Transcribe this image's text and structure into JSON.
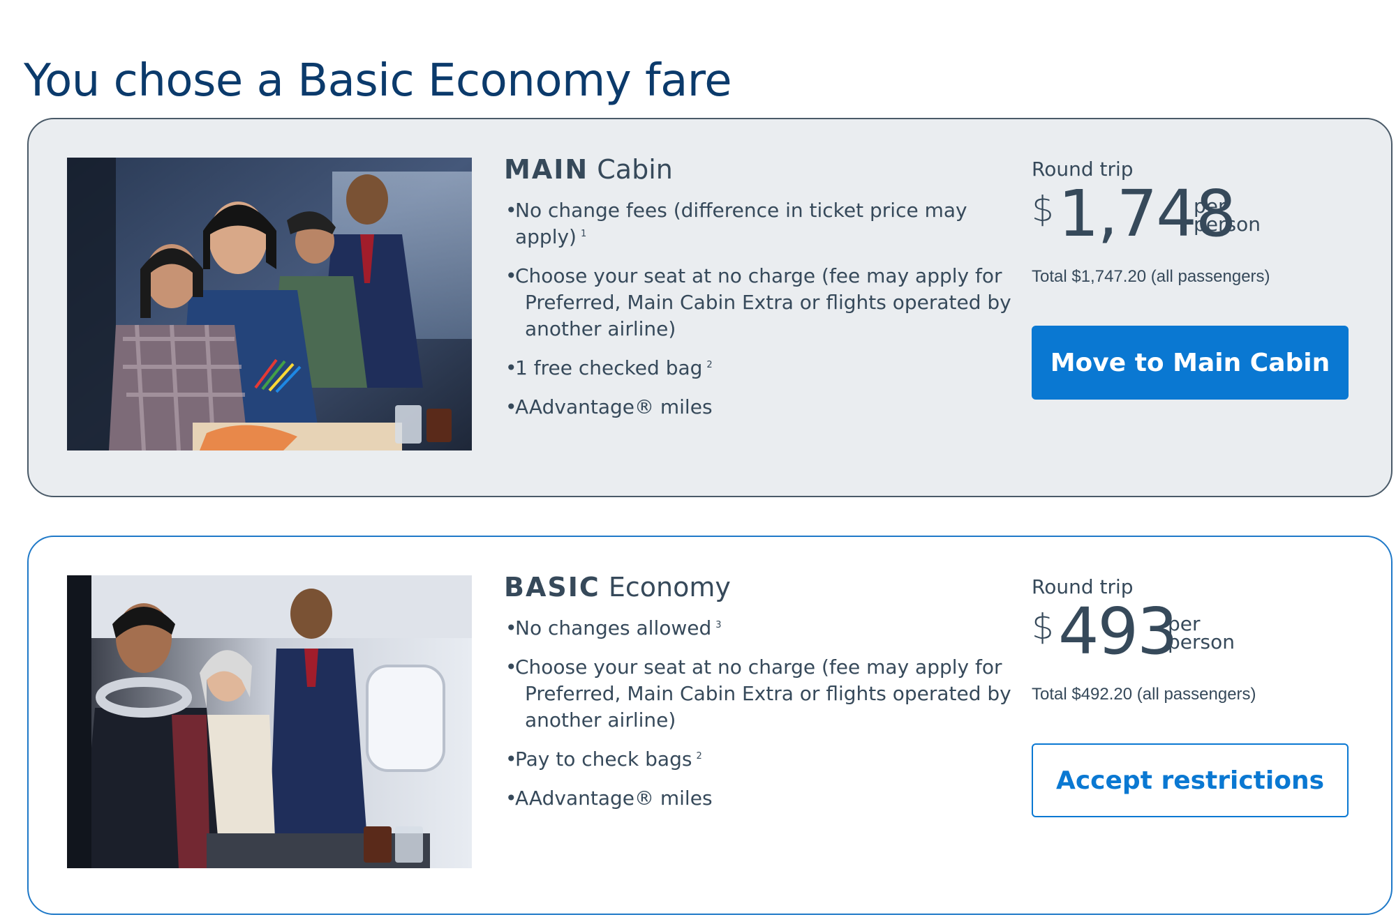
{
  "page": {
    "title": "You chose a Basic Economy fare"
  },
  "colors": {
    "accent": "#0a78d2",
    "title": "#0b3a6b",
    "text": "#36495a",
    "card_bg": "#eaedf0"
  },
  "options": [
    {
      "title_strong": "MAIN",
      "title_rest": "Cabin",
      "features": [
        {
          "text": "No change fees (difference in ticket price may apply)",
          "cont": "",
          "note": "1"
        },
        {
          "text": "Choose your seat at no charge (fee may apply for",
          "cont": "Preferred, Main Cabin Extra or flights operated by another airline)",
          "note": ""
        },
        {
          "text": "1 free checked bag",
          "cont": "",
          "note": "2"
        },
        {
          "text": "AAdvantage® miles",
          "cont": "",
          "note": ""
        }
      ],
      "trip_label": "Round trip",
      "currency": "$",
      "amount": "1,748",
      "per": "per",
      "person": "person",
      "total": "Total $1,747.20 (all passengers)",
      "button_label": "Move to Main Cabin"
    },
    {
      "title_strong": "BASIC",
      "title_rest": "Economy",
      "features": [
        {
          "text": "No changes allowed",
          "cont": "",
          "note": "3"
        },
        {
          "text": "Choose your seat at no charge (fee may apply for",
          "cont": "Preferred, Main Cabin Extra or flights operated by another airline)",
          "note": ""
        },
        {
          "text": "Pay to check bags",
          "cont": "",
          "note": "2"
        },
        {
          "text": "AAdvantage® miles",
          "cont": "",
          "note": ""
        }
      ],
      "trip_label": "Round trip",
      "currency": "$",
      "amount": "493",
      "per": "per",
      "person": "person",
      "total": "Total $492.20 (all passengers)",
      "button_label": "Accept restrictions"
    }
  ]
}
